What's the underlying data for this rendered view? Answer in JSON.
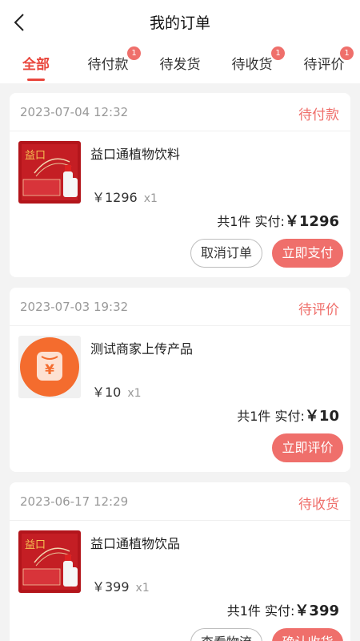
{
  "header": {
    "title": "我的订单"
  },
  "tabs": [
    {
      "label": "全部",
      "badge": ""
    },
    {
      "label": "待付款",
      "badge": "1"
    },
    {
      "label": "待发货",
      "badge": ""
    },
    {
      "label": "待收货",
      "badge": "1"
    },
    {
      "label": "待评价",
      "badge": "1"
    }
  ],
  "orders": [
    {
      "date": "2023-07-04 12:32",
      "status": "待付款",
      "product": {
        "name": "益口通植物饮料",
        "price": "￥1296",
        "qty": "x1"
      },
      "summary": {
        "count_text": "共1件",
        "paid_label": "实付:",
        "paid_amount": "￥1296"
      },
      "buttons": [
        "取消订单",
        "立即支付"
      ]
    },
    {
      "date": "2023-07-03 19:32",
      "status": "待评价",
      "product": {
        "name": "测试商家上传产品",
        "price": "￥10",
        "qty": "x1"
      },
      "summary": {
        "count_text": "共1件",
        "paid_label": "实付:",
        "paid_amount": "￥10"
      },
      "buttons": [
        "立即评价"
      ]
    },
    {
      "date": "2023-06-17 12:29",
      "status": "待收货",
      "product": {
        "name": "益口通植物饮品",
        "price": "￥399",
        "qty": "x1"
      },
      "summary": {
        "count_text": "共1件",
        "paid_label": "实付:",
        "paid_amount": "￥399"
      },
      "buttons": [
        "查看物流",
        "确认收货"
      ]
    }
  ],
  "product_image": {
    "logo_text": "益口",
    "yen_glyph": "¥"
  },
  "colors": {
    "accent": "#e9473d",
    "status": "#ef6f6b",
    "background": "#f3f3f3"
  }
}
